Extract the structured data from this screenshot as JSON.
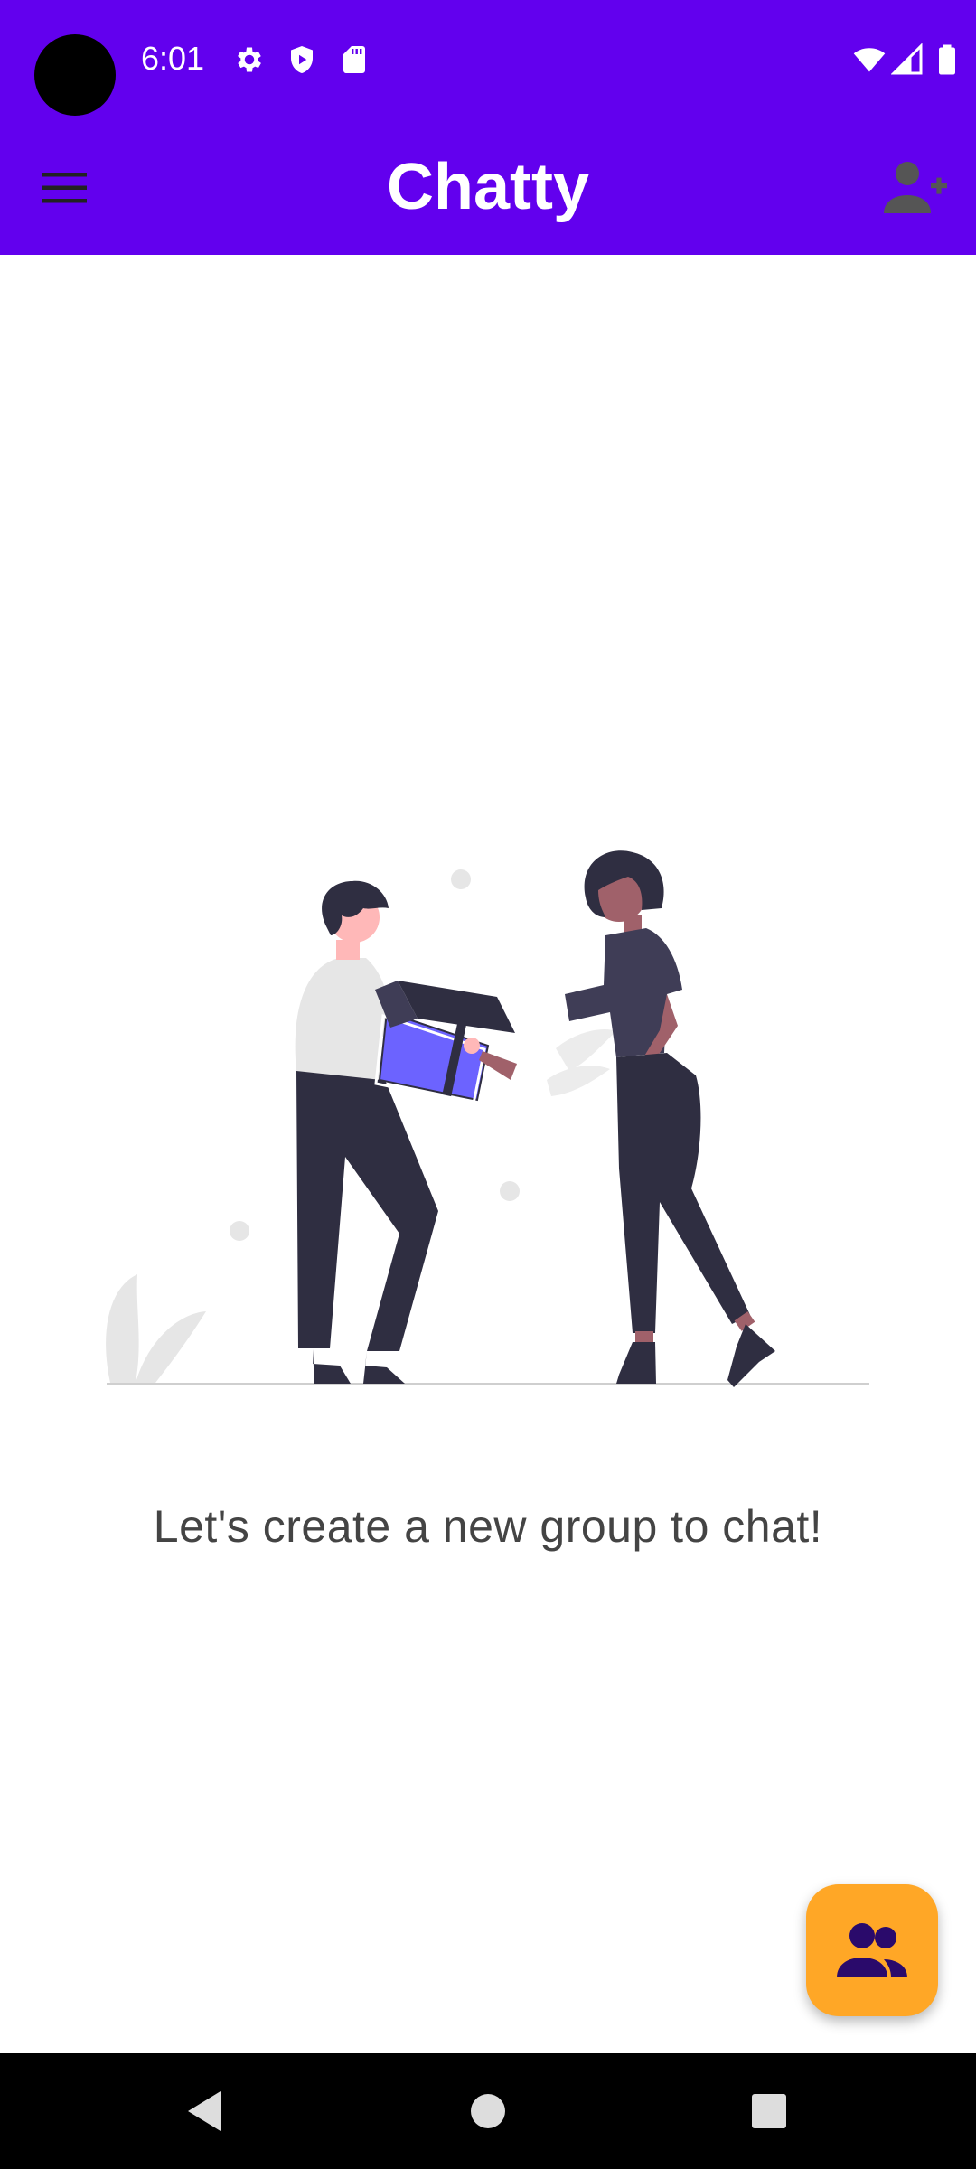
{
  "status_bar": {
    "time": "6:01",
    "icons": [
      "gear-icon",
      "shield-icon",
      "sd-card-icon",
      "wifi-icon",
      "signal-icon",
      "battery-icon"
    ]
  },
  "app_bar": {
    "title": "Chatty",
    "left_icon": "menu-icon",
    "right_icon": "add-person-icon"
  },
  "main": {
    "illustration": "people-exchanging-gift-illustration",
    "empty_message": "Let's create a new group to chat!"
  },
  "fab": {
    "icon": "group-icon"
  },
  "nav_bar": {
    "icons": [
      "back-icon",
      "home-icon",
      "recents-icon"
    ]
  },
  "colors": {
    "primary": "#6200EE",
    "fab": "#FFA726",
    "fab_icon": "#2A0A6B",
    "accent_purple": "#6C63FF",
    "text_dark": "#444444"
  }
}
